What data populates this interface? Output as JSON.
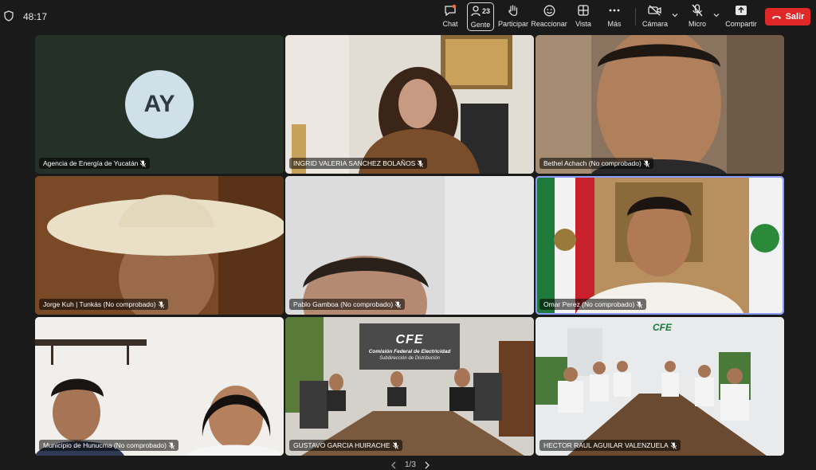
{
  "toolbar": {
    "timer": "48:17",
    "chat_label": "Chat",
    "people_label": "Gente",
    "people_count": "23",
    "participate_label": "Participar",
    "react_label": "Reaccionar",
    "view_label": "Vista",
    "more_label": "Más",
    "camera_label": "Cámara",
    "mic_label": "Micro",
    "share_label": "Compartir",
    "leave_label": "Salir"
  },
  "tiles": [
    {
      "name": "Agencia de Energía de Yucatán",
      "avatar": "AY"
    },
    {
      "name": "INGRID VALERIA SANCHEZ BOLAÑOS"
    },
    {
      "name": "Bethel Achach (No comprobado)"
    },
    {
      "name": "Jorge Kuh | Tunkás (No comprobado)"
    },
    {
      "name": "Pablo Gamboa (No comprobado)"
    },
    {
      "name": "Omar Perez (No comprobado)"
    },
    {
      "name": "Municipio de Hunucma (No comprobado)"
    },
    {
      "name": "GUSTAVO GARCIA HUIRACHE"
    },
    {
      "name": "HECTOR RAUL AGUILAR VALENZUELA"
    }
  ],
  "cfe": {
    "logo": "CFE",
    "line1": "Comisión Federal de Electricidad",
    "line2": "Subdirección de Distribución"
  },
  "pager": {
    "label": "1/3"
  },
  "colors": {
    "leave": "#e02828",
    "active_outline": "#8c9bff",
    "background": "#1a1a1a"
  }
}
